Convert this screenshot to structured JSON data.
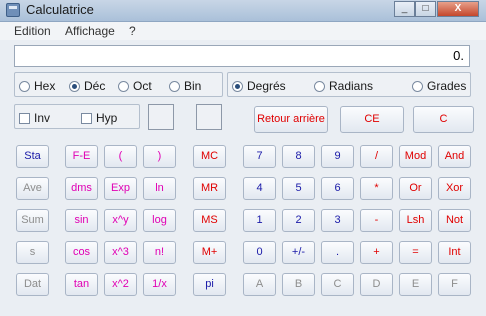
{
  "window": {
    "title": "Calculatrice",
    "minimize": "_",
    "maximize": "□",
    "close": "X"
  },
  "menu": [
    "Edition",
    "Affichage",
    "?"
  ],
  "display": {
    "value": "0."
  },
  "base": {
    "options": [
      "Hex",
      "Déc",
      "Oct",
      "Bin"
    ],
    "selected": "Déc"
  },
  "angle": {
    "options": [
      "Degrés",
      "Radians",
      "Grades"
    ],
    "selected": "Degrés"
  },
  "modifiers": {
    "inv": "Inv",
    "hyp": "Hyp"
  },
  "controls": {
    "backspace": "Retour arrière",
    "ce": "CE",
    "c": "C"
  },
  "keys": {
    "stat": [
      "Sta",
      "Ave",
      "Sum",
      "s",
      "Dat"
    ],
    "sci1": [
      "F-E",
      "dms",
      "sin",
      "cos",
      "tan"
    ],
    "sci2": [
      "(",
      "Exp",
      "x^y",
      "x^3",
      "x^2"
    ],
    "sci3": [
      ")",
      "ln",
      "log",
      "n!",
      "1/x"
    ],
    "memory": [
      "MC",
      "MR",
      "MS",
      "M+",
      "pi"
    ],
    "digits1": [
      "7",
      "4",
      "1",
      "0",
      "A"
    ],
    "digits2": [
      "8",
      "5",
      "2",
      "+/-",
      "B"
    ],
    "digits3": [
      "9",
      "6",
      "3",
      ".",
      "C"
    ],
    "ops1": [
      "/",
      "*",
      "-",
      "+",
      "D"
    ],
    "ops2": [
      "Mod",
      "Or",
      "Lsh",
      "=",
      "E"
    ],
    "ops3": [
      "And",
      "Xor",
      "Not",
      "Int",
      "F"
    ]
  }
}
